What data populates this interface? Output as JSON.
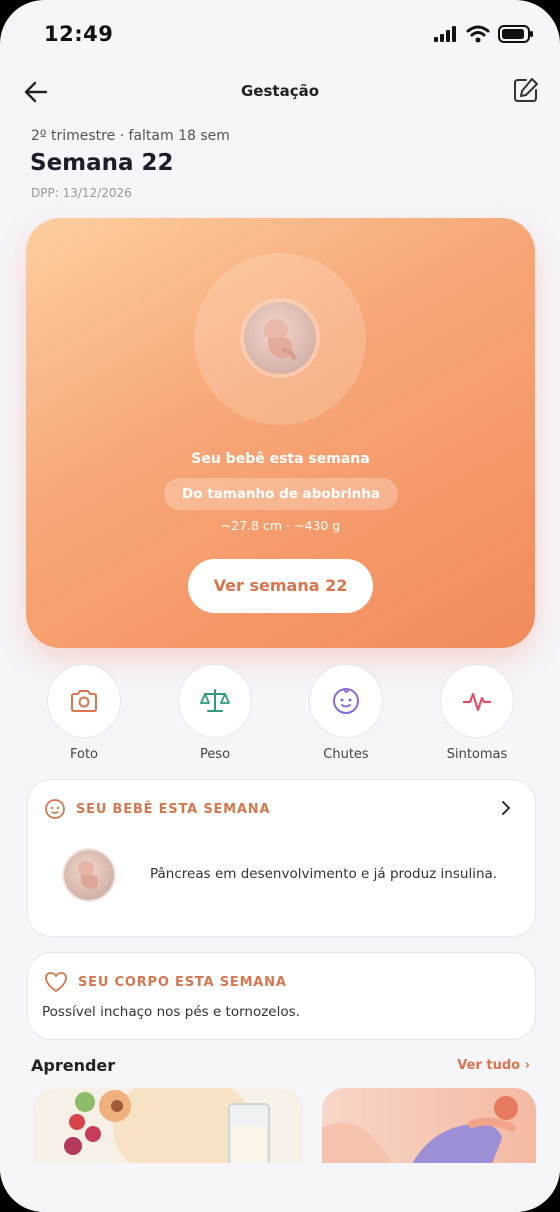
{
  "status_bar": {
    "time": "12:49"
  },
  "header": {
    "title": "Gestação"
  },
  "pregnancy": {
    "subtitle": "2º trimestre · faltam 18 sem",
    "week_title": "Semana 22",
    "due_date": "DPP: 13/12/2026"
  },
  "hero": {
    "title": "Seu bebê esta semana",
    "size_pill": "Do tamanho de abobrinha",
    "measurements": "~27.8 cm · ~430 g",
    "button_label": "Ver semana 22"
  },
  "quick_actions": [
    {
      "label": "Foto",
      "icon": "camera-icon",
      "color": "#d9744c"
    },
    {
      "label": "Peso",
      "icon": "scale-icon",
      "color": "#2e9a7e"
    },
    {
      "label": "Chutes",
      "icon": "baby-face-icon",
      "color": "#8a6ad8"
    },
    {
      "label": "Sintomas",
      "icon": "pulse-icon",
      "color": "#e0506e"
    }
  ],
  "baby_card": {
    "heading": "SEU BEBÊ ESTA SEMANA",
    "text": "Pâncreas em desenvolvimento e já produz insulina."
  },
  "body_card": {
    "heading": "SEU CORPO ESTA SEMANA",
    "text": "Possível inchaço nos pés e tornozelos."
  },
  "learn": {
    "title": "Aprender",
    "see_all": "Ver tudo ›"
  },
  "colors": {
    "accent": "#d9744c",
    "background": "#f6f5fa",
    "hero_gradient_start": "#fdcfa0",
    "hero_gradient_end": "#f28a5a"
  }
}
